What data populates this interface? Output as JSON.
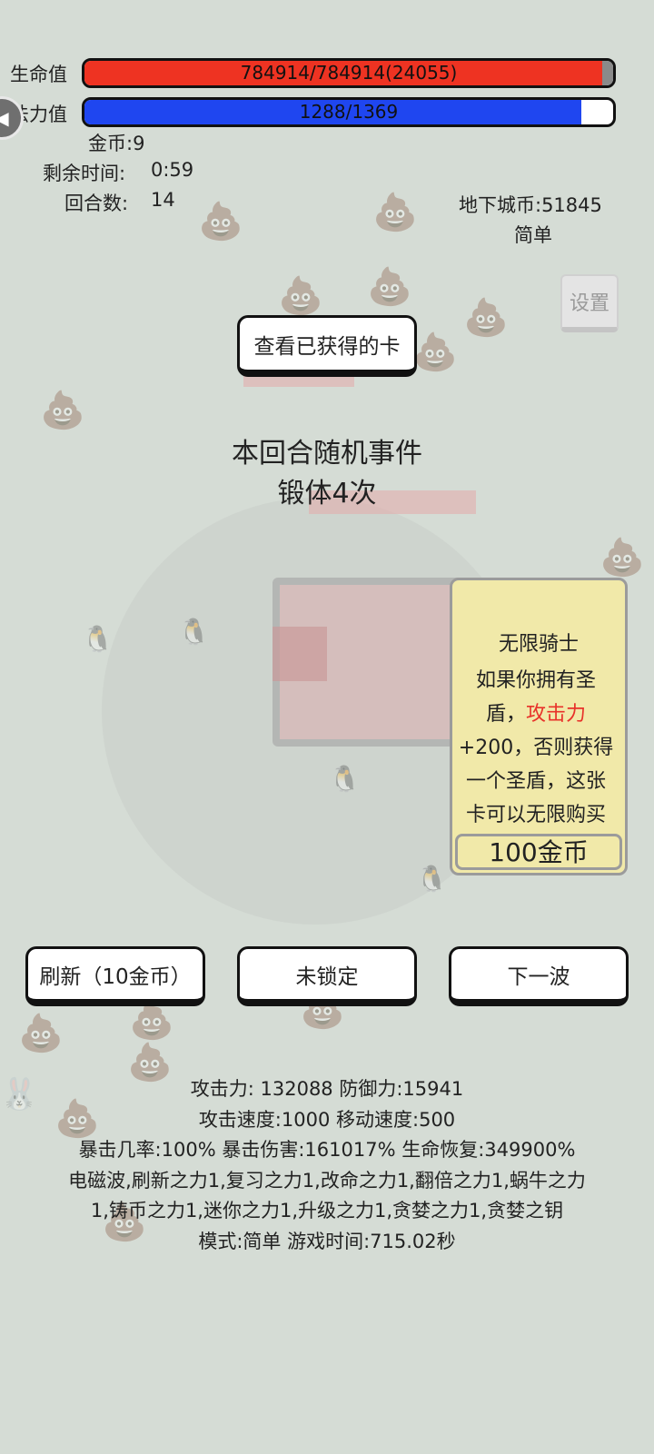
{
  "hud": {
    "hp_label": "生命值",
    "hp_text": "784914/784914(24055)",
    "hp_fill_percent": 98,
    "hp_color": "#ee3322",
    "mp_label": "法力值",
    "mp_text": "1288/1369",
    "mp_fill_percent": 94,
    "mp_color": "#1f46f0",
    "gold": "金币:9",
    "time_left_label": "剩余时间:",
    "time_left": "0:59",
    "round_label": "回合数:",
    "round": "14",
    "dungeon_coins": "地下城币:51845",
    "difficulty": "简单",
    "back_icon": "volume-icon"
  },
  "settings_label": "设置",
  "view_cards_label": "查看已获得的卡",
  "event": {
    "title": "本回合随机事件",
    "detail": "锻体4次"
  },
  "card": {
    "name": "无限骑士",
    "desc_line1": "如果你拥有圣",
    "desc_line2_pre": "盾，",
    "desc_line2_highlight": "攻击力",
    "desc_line3": "+200，否则获得",
    "desc_line4": "一个圣盾，这张",
    "desc_line5": "卡可以无限购买",
    "price": "100金币",
    "highlight_color": "#e8322a"
  },
  "actions": {
    "refresh": "刷新（10金币）",
    "lock": "未锁定",
    "next_wave": "下一波"
  },
  "stats": {
    "line1": "攻击力:  132088 防御力:15941",
    "line2": "攻击速度:1000 移动速度:500",
    "line3": "暴击几率:100% 暴击伤害:161017% 生命恢复:349900%",
    "line4": "电磁波,刷新之力1,复习之力1,改命之力1,翻倍之力1,蜗牛之力",
    "line5": "1,铸币之力1,迷你之力1,升级之力1,贪婪之力1,贪婪之钥",
    "line6": "模式:简单 游戏时间:715.02秒"
  }
}
